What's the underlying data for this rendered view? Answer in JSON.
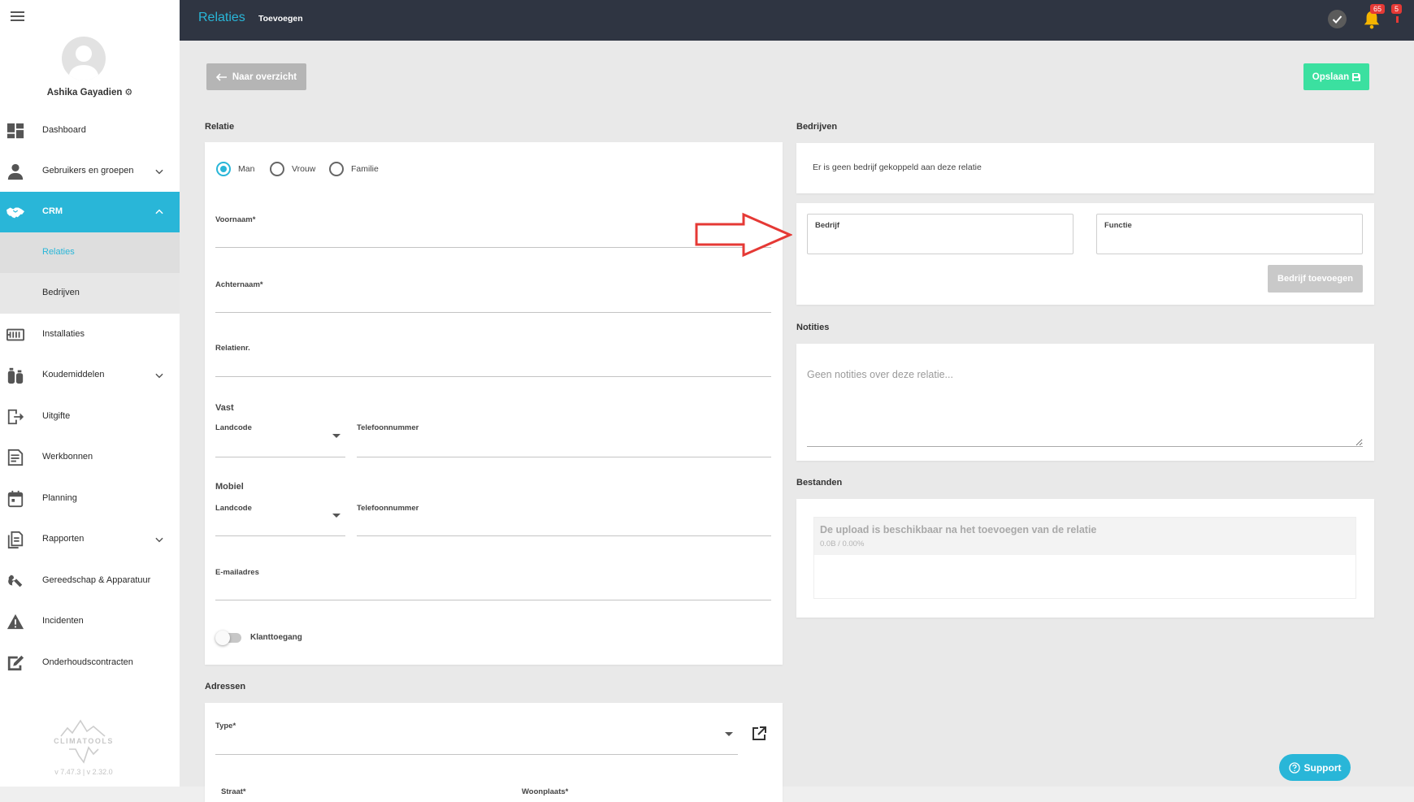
{
  "colors": {
    "accent": "#29b6d8",
    "topbar": "#2f3542",
    "save_button": "#3be0a0",
    "disabled_button": "#c9c9c9",
    "badge": "#e53935",
    "annotation_arrow": "#e53935"
  },
  "topbar": {
    "title": "Relaties",
    "subtitle": "Toevoegen",
    "notifications_badge": "65",
    "alerts_badge": "5"
  },
  "user": {
    "name": "Ashika Gayadien"
  },
  "sidebar": {
    "items": [
      {
        "label": "Dashboard",
        "icon": "dashboard-icon"
      },
      {
        "label": "Gebruikers en groepen",
        "icon": "users-icon",
        "expandable": true
      },
      {
        "label": "CRM",
        "icon": "handshake-icon",
        "expandable": true,
        "expanded": true,
        "active": true
      },
      {
        "label": "Relaties",
        "submenu": true,
        "active": true
      },
      {
        "label": "Bedrijven",
        "submenu": true
      },
      {
        "label": "Installaties",
        "icon": "installations-icon"
      },
      {
        "label": "Koudemiddelen",
        "icon": "gas-cylinders-icon",
        "expandable": true
      },
      {
        "label": "Uitgifte",
        "icon": "exit-icon"
      },
      {
        "label": "Werkbonnen",
        "icon": "work-order-icon"
      },
      {
        "label": "Planning",
        "icon": "calendar-icon"
      },
      {
        "label": "Rapporten",
        "icon": "reports-icon",
        "expandable": true
      },
      {
        "label": "Gereedschap & Apparatuur",
        "icon": "wrench-icon"
      },
      {
        "label": "Incidenten",
        "icon": "warning-icon"
      },
      {
        "label": "Onderhoudscontracten",
        "icon": "contract-icon"
      }
    ]
  },
  "logo": {
    "text": "CLIMATOOLS",
    "version": "v 7.47.3 | v 2.32.0"
  },
  "actions": {
    "back_label": "Naar overzicht",
    "save_label": "Opslaan"
  },
  "relatie": {
    "section_title": "Relatie",
    "gender_options": [
      {
        "label": "Man",
        "checked": true
      },
      {
        "label": "Vrouw",
        "checked": false
      },
      {
        "label": "Familie",
        "checked": false
      }
    ],
    "voornaam_label": "Voornaam*",
    "achternaam_label": "Achternaam*",
    "relatienr_label": "Relatienr.",
    "vast": {
      "title": "Vast",
      "landcode_label": "Landcode",
      "telefoon_label": "Telefoonnummer"
    },
    "mobiel": {
      "title": "Mobiel",
      "landcode_label": "Landcode",
      "telefoon_label": "Telefoonnummer"
    },
    "email_label": "E-mailadres",
    "klanttoegang": {
      "label": "Klanttoegang",
      "enabled": false
    }
  },
  "adressen": {
    "section_title": "Adressen",
    "type_label": "Type*",
    "straat_label": "Straat*",
    "woonplaats_label": "Woonplaats*"
  },
  "bedrijven": {
    "section_title": "Bedrijven",
    "empty_text": "Er is geen bedrijf gekoppeld aan deze relatie",
    "bedrijf_label": "Bedrijf",
    "functie_label": "Functie",
    "add_button": "Bedrijf toevoegen"
  },
  "notities": {
    "section_title": "Notities",
    "placeholder": "Geen notities over deze relatie..."
  },
  "bestanden": {
    "section_title": "Bestanden",
    "upload_message": "De upload is beschikbaar na het toevoegen van de relatie",
    "upload_progress": "0.0B / 0.00%"
  },
  "support": {
    "label": "Support"
  }
}
